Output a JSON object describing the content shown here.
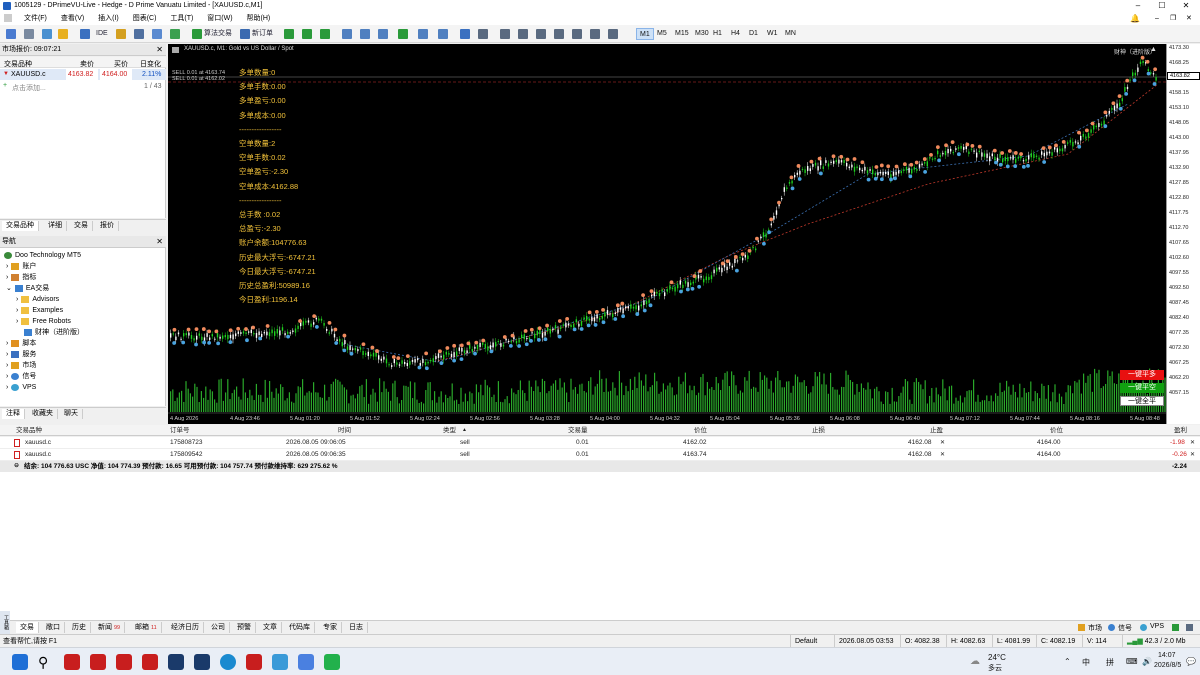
{
  "window": {
    "title": "1005129 - DPrimeVU-Live - Hedge - D Prime Vanuatu Limited - [XAUUSD.c,M1]"
  },
  "menu": [
    "文件(F)",
    "查看(V)",
    "插入(I)",
    "图表(C)",
    "工具(T)",
    "窗口(W)",
    "帮助(H)"
  ],
  "toolbar": {
    "ide": "IDE",
    "algo_trading": "算法交易",
    "new_order": "新订单",
    "timeframes": [
      "M1",
      "M5",
      "M15",
      "M30",
      "H1",
      "H4",
      "D1",
      "W1",
      "MN"
    ],
    "active_timeframe": "M1"
  },
  "market_watch": {
    "title": "市场报价: 09:07:21",
    "headers": [
      "交易品种",
      "卖价",
      "买价",
      "日变化"
    ],
    "row": {
      "symbol": "XAUUSD.c",
      "bid": "4163.82",
      "ask": "4164.00",
      "change": "2.11%"
    },
    "add": "点击添加...",
    "count": "1 / 43",
    "tabs": [
      "交易品种",
      "详细",
      "交易",
      "报价"
    ]
  },
  "navigator": {
    "title": "导航",
    "items": [
      "Doo Technology MT5",
      "账户",
      "指标",
      "EA交易",
      "Advisors",
      "Examples",
      "Free Robots",
      "财神（进阶版）",
      "脚本",
      "服务",
      "市场",
      "信号",
      "VPS"
    ],
    "tabs": [
      "注释",
      "收藏夹",
      "聊天"
    ]
  },
  "chart": {
    "symbol_label": "XAUUSD.c, M1:  Gold vs US Dollar / Spot",
    "sell_lines": [
      "SELL 0.01 at 4163.74",
      "SELL 0.01 at 4162.02"
    ],
    "ea_label": "财神（进阶版）",
    "info": [
      "多单数量:0",
      "多单手数:0.00",
      "多单盈亏:0.00",
      "多单成本:0.00",
      "-----------------",
      "空单数量:2",
      "空单手数:0.02",
      "空单盈亏:-2.30",
      "空单成本:4162.88",
      "-----------------",
      "总手数 :0.02",
      "总盈亏:-2.30",
      "账户余额:104776.63",
      "历史最大浮亏:-6747.21",
      "今日最大浮亏:-6747.21",
      "历史总盈利:50989.16",
      "今日盈利:1196.14"
    ],
    "buttons": {
      "close_buy": "一键平多",
      "close_sell": "一键平空",
      "close_all": "一键全平"
    },
    "price_labels": [
      "4173.30",
      "4168.25",
      "4163.45",
      "4158.15",
      "4153.10",
      "4148.05",
      "4143.00",
      "4137.95",
      "4132.90",
      "4127.85",
      "4122.80",
      "4117.75",
      "4112.70",
      "4107.65",
      "4102.60",
      "4097.55",
      "4092.50",
      "4087.45",
      "4082.40",
      "4077.35",
      "4072.30",
      "4067.25",
      "4062.20",
      "4057.15"
    ],
    "current_price": "4163.82",
    "time_labels": [
      "4 Aug 2026",
      "4 Aug 23:46",
      "5 Aug 01:20",
      "5 Aug 01:52",
      "5 Aug 02:24",
      "5 Aug 02:56",
      "5 Aug 03:28",
      "5 Aug 04:00",
      "5 Aug 04:32",
      "5 Aug 05:04",
      "5 Aug 05:36",
      "5 Aug 06:08",
      "5 Aug 06:40",
      "5 Aug 07:12",
      "5 Aug 07:44",
      "5 Aug 08:16",
      "5 Aug 08:48"
    ],
    "colors": {
      "bull": "#1fd21f",
      "bear": "#ffffff",
      "sell_marker": "#f08a5d",
      "buy_marker": "#4aa3df",
      "info_text": "#f2c23a",
      "volume": "#2aa82a"
    }
  },
  "trades": {
    "headers": [
      "交易品种",
      "订单号",
      "时间",
      "类型",
      "交易量",
      "价位",
      "止损",
      "止盈",
      "价位",
      "盈利"
    ],
    "rows": [
      {
        "symbol": "xauusd.c",
        "ticket": "175808723",
        "time": "2026.08.05 09:06:05",
        "type": "sell",
        "volume": "0.01",
        "price": "4162.02",
        "sl": "",
        "tp": "4162.08",
        "current": "4164.00",
        "profit": "-1.98"
      },
      {
        "symbol": "xauusd.c",
        "ticket": "175809542",
        "time": "2026.08.05 09:06:35",
        "type": "sell",
        "volume": "0.01",
        "price": "4163.74",
        "sl": "",
        "tp": "4162.08",
        "current": "4164.00",
        "profit": "-0.26"
      }
    ],
    "balance_line": "结余: 104 776.63 USC  净值: 104 774.39  预付款: 16.65  可用预付款: 104 757.74  预付款维持率: 629 275.62 %",
    "total_profit": "-2.24"
  },
  "bottom_tabs": [
    {
      "label": "交易",
      "badge": ""
    },
    {
      "label": "敞口",
      "badge": ""
    },
    {
      "label": "历史",
      "badge": ""
    },
    {
      "label": "新闻",
      "badge": "99"
    },
    {
      "label": "邮箱",
      "badge": "11"
    },
    {
      "label": "经济日历",
      "badge": ""
    },
    {
      "label": "公司",
      "badge": ""
    },
    {
      "label": "预警",
      "badge": ""
    },
    {
      "label": "文章",
      "badge": ""
    },
    {
      "label": "代码库",
      "badge": ""
    },
    {
      "label": "专家",
      "badge": ""
    },
    {
      "label": "日志",
      "badge": ""
    }
  ],
  "bottom_right_tabs": [
    "市场",
    "信号",
    "VPS"
  ],
  "side_label": "工具箱",
  "status": {
    "help": "查看帮忙,请按 F1",
    "profile": "Default",
    "datetime": "2026.08.05 03:53",
    "open": "O: 4082.38",
    "high": "H: 4082.63",
    "low": "L: 4081.99",
    "close": "C: 4082.19",
    "volume": "V: 114",
    "net": "42.3 / 2.0 Mb"
  },
  "taskbar": {
    "weather_temp": "24°C",
    "weather_desc": "多云",
    "ime1": "中",
    "ime2": "拼",
    "time": "14:07",
    "date": "2026/8/5"
  }
}
